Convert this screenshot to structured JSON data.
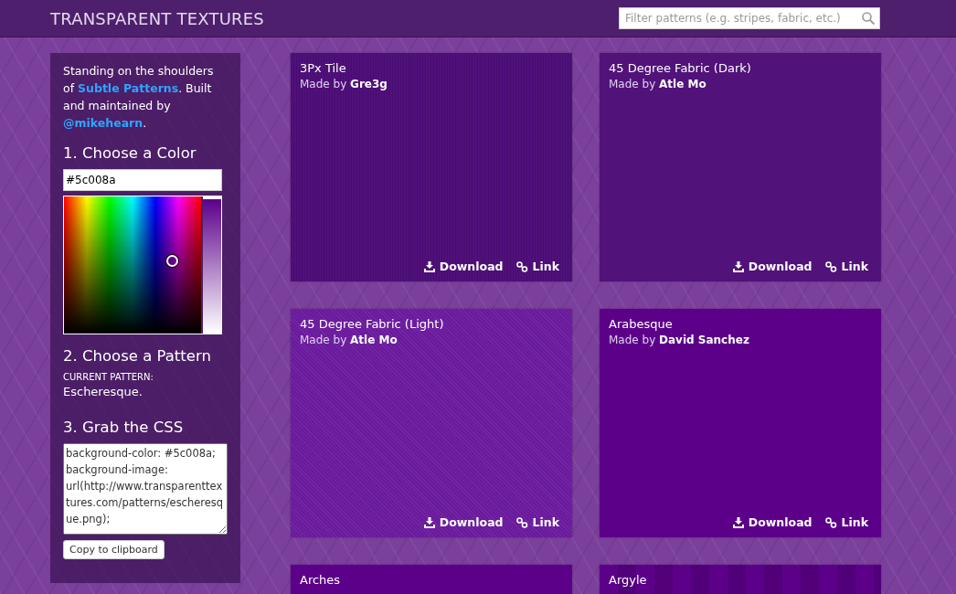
{
  "header": {
    "title": "TRANSPARENT TEXTURES",
    "search": {
      "placeholder": "Filter patterns (e.g. stripes, fabric, etc.)"
    }
  },
  "sidebar": {
    "intro": {
      "text_1": "Standing on the shoulders of ",
      "link_1": "Subtle Patterns",
      "text_2": ". Built and maintained by ",
      "link_2": "@mikehearn",
      "text_3": "."
    },
    "step_1": "1. Choose a Color",
    "color_value": "#5c008a",
    "step_2": "2. Choose a Pattern",
    "current_label": "CURRENT PATTERN:",
    "current_pattern": "Escheresque.",
    "step_3": "3. Grab the CSS",
    "css": "background-color: #5c008a;\nbackground-image: url(http://www.transparenttextures.com/patterns/escheresque.png);",
    "copy_button": "Copy to clipboard"
  },
  "patterns": [
    {
      "title": "3Px Tile",
      "made_by": "Made by",
      "author": "Gre3g",
      "download": "Download",
      "link": "Link",
      "kind": "tile"
    },
    {
      "title": "45 Degree Fabric (Dark)",
      "made_by": "Made by",
      "author": "Atle Mo",
      "download": "Download",
      "link": "Link",
      "kind": "dark"
    },
    {
      "title": "45 Degree Fabric (Light)",
      "made_by": "Made by",
      "author": "Atle Mo",
      "download": "Download",
      "link": "Link",
      "kind": "light"
    },
    {
      "title": "Arabesque",
      "made_by": "Made by",
      "author": "David Sanchez",
      "download": "Download",
      "link": "Link",
      "kind": "plain"
    },
    {
      "title": "Arches",
      "kind": "plain"
    },
    {
      "title": "Argyle",
      "kind": "argyle"
    }
  ]
}
